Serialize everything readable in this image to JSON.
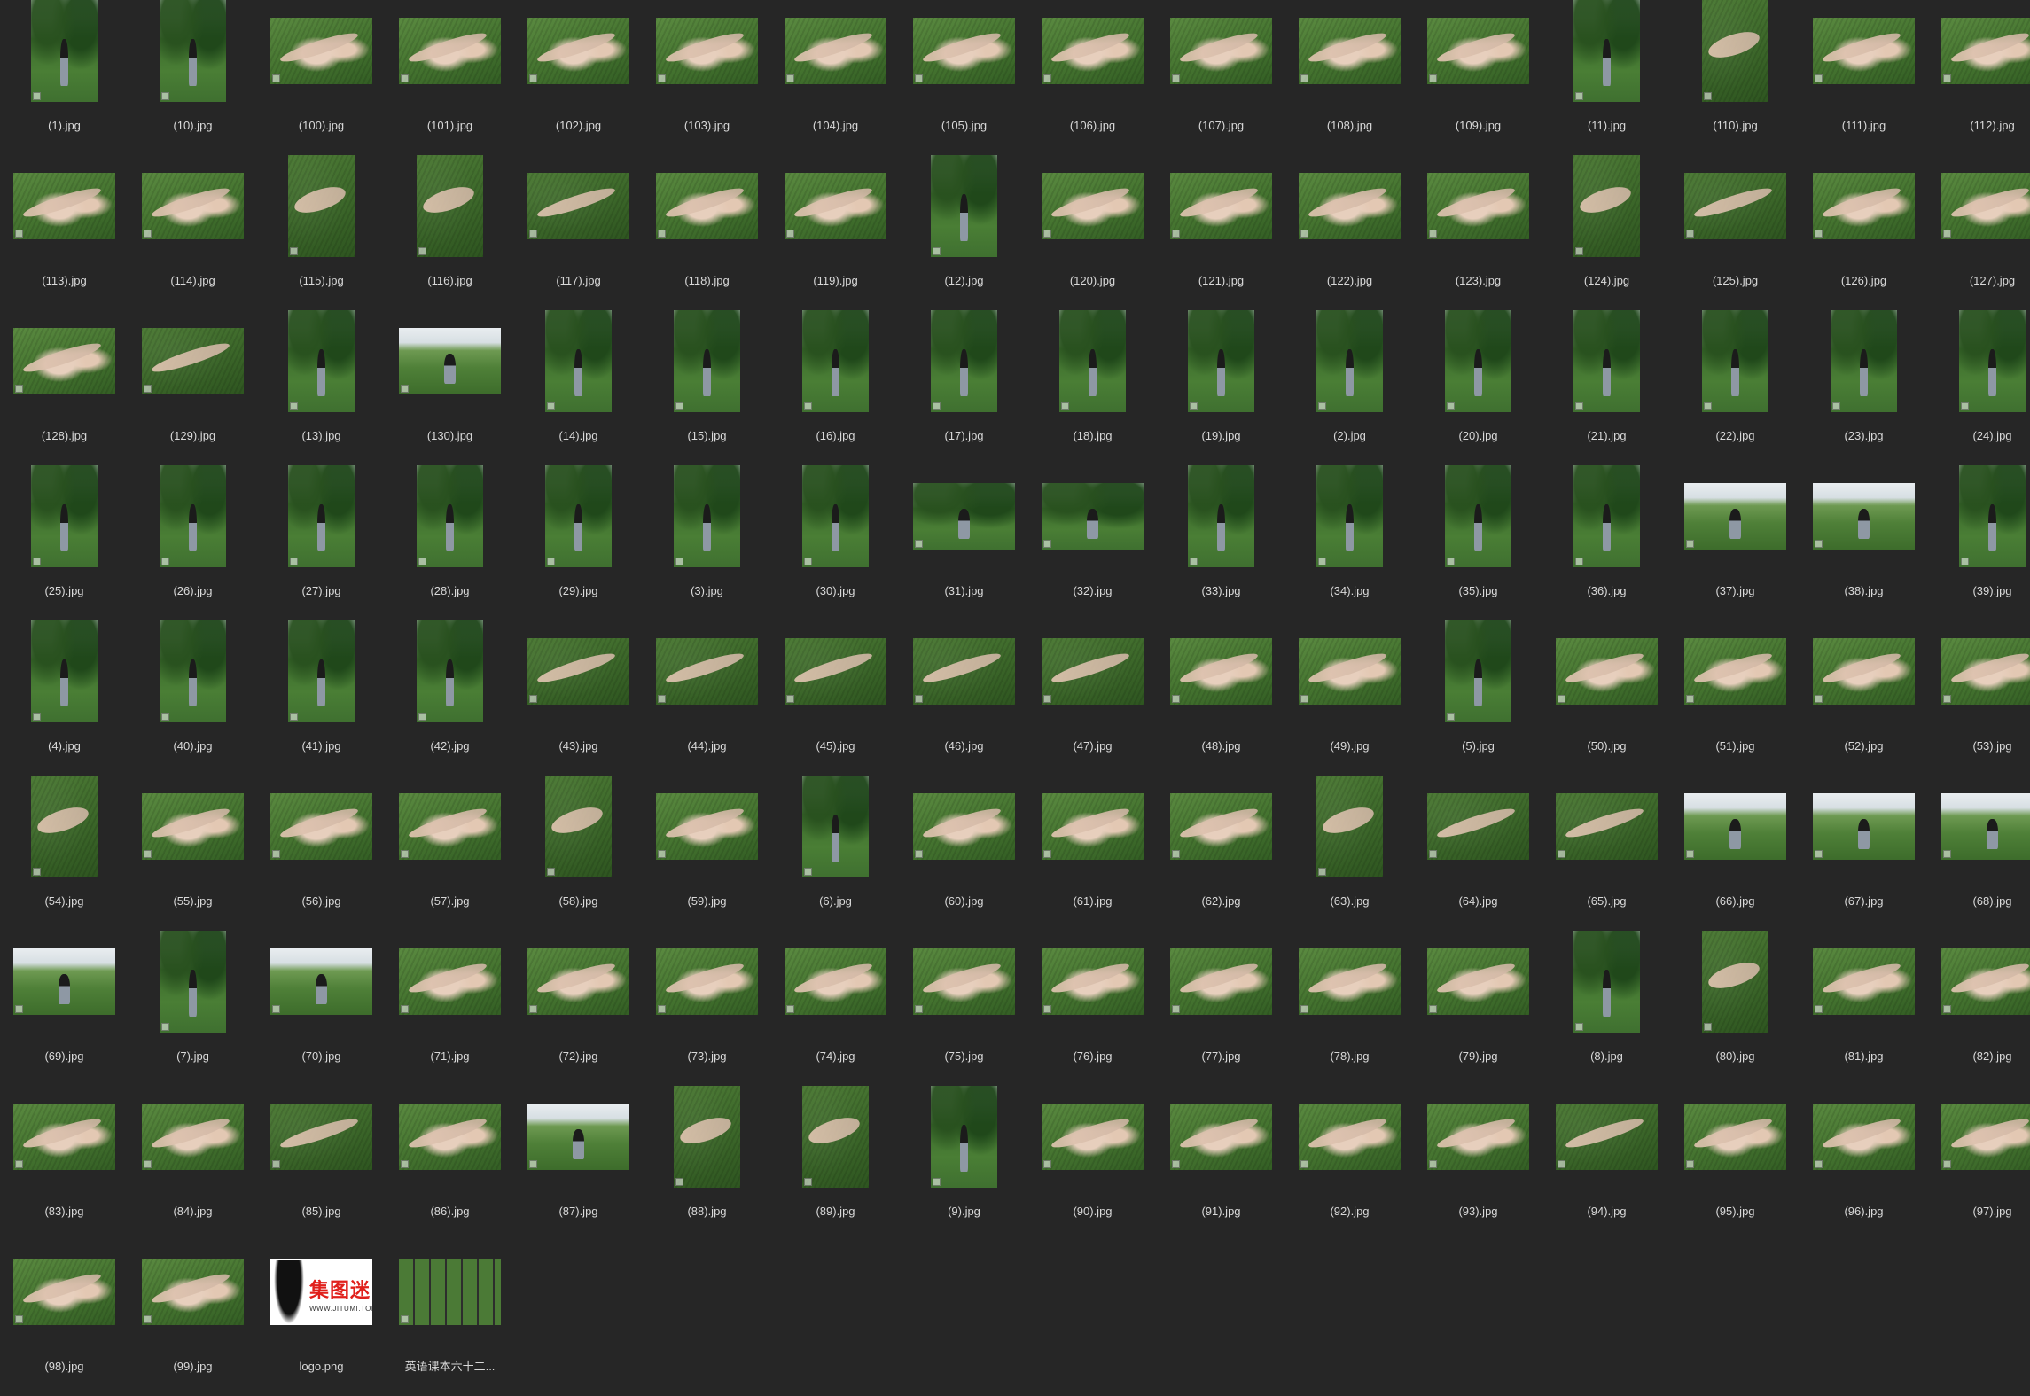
{
  "window": {
    "background": "#262626"
  },
  "grid": {
    "columns": 16,
    "items": [
      {
        "name": "(1).jpg",
        "orientation": "portrait",
        "scene": "trees"
      },
      {
        "name": "(10).jpg",
        "orientation": "portrait",
        "scene": "trees"
      },
      {
        "name": "(100).jpg",
        "orientation": "landscape",
        "scene": "feet"
      },
      {
        "name": "(101).jpg",
        "orientation": "landscape",
        "scene": "feet"
      },
      {
        "name": "(102).jpg",
        "orientation": "landscape",
        "scene": "feet"
      },
      {
        "name": "(103).jpg",
        "orientation": "landscape",
        "scene": "feet"
      },
      {
        "name": "(104).jpg",
        "orientation": "landscape",
        "scene": "feet"
      },
      {
        "name": "(105).jpg",
        "orientation": "landscape",
        "scene": "feet"
      },
      {
        "name": "(106).jpg",
        "orientation": "landscape",
        "scene": "feet"
      },
      {
        "name": "(107).jpg",
        "orientation": "landscape",
        "scene": "feet"
      },
      {
        "name": "(108).jpg",
        "orientation": "landscape",
        "scene": "feet"
      },
      {
        "name": "(109).jpg",
        "orientation": "landscape",
        "scene": "feet"
      },
      {
        "name": "(11).jpg",
        "orientation": "portrait",
        "scene": "trees"
      },
      {
        "name": "(110).jpg",
        "orientation": "portrait",
        "scene": "grass"
      },
      {
        "name": "(111).jpg",
        "orientation": "landscape",
        "scene": "feet"
      },
      {
        "name": "(112).jpg",
        "orientation": "landscape",
        "scene": "feet"
      },
      {
        "name": "(113).jpg",
        "orientation": "landscape",
        "scene": "feet"
      },
      {
        "name": "(114).jpg",
        "orientation": "landscape",
        "scene": "feet"
      },
      {
        "name": "(115).jpg",
        "orientation": "portrait",
        "scene": "grass"
      },
      {
        "name": "(116).jpg",
        "orientation": "portrait",
        "scene": "grass"
      },
      {
        "name": "(117).jpg",
        "orientation": "landscape",
        "scene": "grass"
      },
      {
        "name": "(118).jpg",
        "orientation": "landscape",
        "scene": "feet"
      },
      {
        "name": "(119).jpg",
        "orientation": "landscape",
        "scene": "feet"
      },
      {
        "name": "(12).jpg",
        "orientation": "portrait",
        "scene": "trees"
      },
      {
        "name": "(120).jpg",
        "orientation": "landscape",
        "scene": "feet"
      },
      {
        "name": "(121).jpg",
        "orientation": "landscape",
        "scene": "feet"
      },
      {
        "name": "(122).jpg",
        "orientation": "landscape",
        "scene": "feet"
      },
      {
        "name": "(123).jpg",
        "orientation": "landscape",
        "scene": "feet"
      },
      {
        "name": "(124).jpg",
        "orientation": "portrait",
        "scene": "grass"
      },
      {
        "name": "(125).jpg",
        "orientation": "landscape",
        "scene": "grass"
      },
      {
        "name": "(126).jpg",
        "orientation": "landscape",
        "scene": "feet"
      },
      {
        "name": "(127).jpg",
        "orientation": "landscape",
        "scene": "feet"
      },
      {
        "name": "(128).jpg",
        "orientation": "landscape",
        "scene": "feet"
      },
      {
        "name": "(129).jpg",
        "orientation": "landscape",
        "scene": "grass"
      },
      {
        "name": "(13).jpg",
        "orientation": "portrait",
        "scene": "trees"
      },
      {
        "name": "(130).jpg",
        "orientation": "landscape",
        "scene": "lawn"
      },
      {
        "name": "(14).jpg",
        "orientation": "portrait",
        "scene": "trees"
      },
      {
        "name": "(15).jpg",
        "orientation": "portrait",
        "scene": "trees"
      },
      {
        "name": "(16).jpg",
        "orientation": "portrait",
        "scene": "trees"
      },
      {
        "name": "(17).jpg",
        "orientation": "portrait",
        "scene": "trees"
      },
      {
        "name": "(18).jpg",
        "orientation": "portrait",
        "scene": "trees"
      },
      {
        "name": "(19).jpg",
        "orientation": "portrait",
        "scene": "trees"
      },
      {
        "name": "(2).jpg",
        "orientation": "portrait",
        "scene": "trees"
      },
      {
        "name": "(20).jpg",
        "orientation": "portrait",
        "scene": "trees"
      },
      {
        "name": "(21).jpg",
        "orientation": "portrait",
        "scene": "trees"
      },
      {
        "name": "(22).jpg",
        "orientation": "portrait",
        "scene": "trees"
      },
      {
        "name": "(23).jpg",
        "orientation": "portrait",
        "scene": "trees"
      },
      {
        "name": "(24).jpg",
        "orientation": "portrait",
        "scene": "trees"
      },
      {
        "name": "(25).jpg",
        "orientation": "portrait",
        "scene": "trees"
      },
      {
        "name": "(26).jpg",
        "orientation": "portrait",
        "scene": "trees"
      },
      {
        "name": "(27).jpg",
        "orientation": "portrait",
        "scene": "trees"
      },
      {
        "name": "(28).jpg",
        "orientation": "portrait",
        "scene": "trees"
      },
      {
        "name": "(29).jpg",
        "orientation": "portrait",
        "scene": "trees"
      },
      {
        "name": "(3).jpg",
        "orientation": "portrait",
        "scene": "trees"
      },
      {
        "name": "(30).jpg",
        "orientation": "portrait",
        "scene": "trees"
      },
      {
        "name": "(31).jpg",
        "orientation": "landscape",
        "scene": "trees"
      },
      {
        "name": "(32).jpg",
        "orientation": "landscape",
        "scene": "trees"
      },
      {
        "name": "(33).jpg",
        "orientation": "portrait",
        "scene": "trees"
      },
      {
        "name": "(34).jpg",
        "orientation": "portrait",
        "scene": "trees"
      },
      {
        "name": "(35).jpg",
        "orientation": "portrait",
        "scene": "trees"
      },
      {
        "name": "(36).jpg",
        "orientation": "portrait",
        "scene": "trees"
      },
      {
        "name": "(37).jpg",
        "orientation": "landscape",
        "scene": "lawn"
      },
      {
        "name": "(38).jpg",
        "orientation": "landscape",
        "scene": "lawn"
      },
      {
        "name": "(39).jpg",
        "orientation": "portrait",
        "scene": "trees"
      },
      {
        "name": "(4).jpg",
        "orientation": "portrait",
        "scene": "trees"
      },
      {
        "name": "(40).jpg",
        "orientation": "portrait",
        "scene": "trees"
      },
      {
        "name": "(41).jpg",
        "orientation": "portrait",
        "scene": "trees"
      },
      {
        "name": "(42).jpg",
        "orientation": "portrait",
        "scene": "trees"
      },
      {
        "name": "(43).jpg",
        "orientation": "landscape",
        "scene": "grass"
      },
      {
        "name": "(44).jpg",
        "orientation": "landscape",
        "scene": "grass"
      },
      {
        "name": "(45).jpg",
        "orientation": "landscape",
        "scene": "grass"
      },
      {
        "name": "(46).jpg",
        "orientation": "landscape",
        "scene": "grass"
      },
      {
        "name": "(47).jpg",
        "orientation": "landscape",
        "scene": "grass"
      },
      {
        "name": "(48).jpg",
        "orientation": "landscape",
        "scene": "feet"
      },
      {
        "name": "(49).jpg",
        "orientation": "landscape",
        "scene": "feet"
      },
      {
        "name": "(5).jpg",
        "orientation": "portrait",
        "scene": "trees"
      },
      {
        "name": "(50).jpg",
        "orientation": "landscape",
        "scene": "feet"
      },
      {
        "name": "(51).jpg",
        "orientation": "landscape",
        "scene": "feet"
      },
      {
        "name": "(52).jpg",
        "orientation": "landscape",
        "scene": "feet"
      },
      {
        "name": "(53).jpg",
        "orientation": "landscape",
        "scene": "feet"
      },
      {
        "name": "(54).jpg",
        "orientation": "portrait",
        "scene": "grass"
      },
      {
        "name": "(55).jpg",
        "orientation": "landscape",
        "scene": "feet"
      },
      {
        "name": "(56).jpg",
        "orientation": "landscape",
        "scene": "feet"
      },
      {
        "name": "(57).jpg",
        "orientation": "landscape",
        "scene": "feet"
      },
      {
        "name": "(58).jpg",
        "orientation": "portrait",
        "scene": "grass"
      },
      {
        "name": "(59).jpg",
        "orientation": "landscape",
        "scene": "feet"
      },
      {
        "name": "(6).jpg",
        "orientation": "portrait",
        "scene": "trees"
      },
      {
        "name": "(60).jpg",
        "orientation": "landscape",
        "scene": "feet"
      },
      {
        "name": "(61).jpg",
        "orientation": "landscape",
        "scene": "feet"
      },
      {
        "name": "(62).jpg",
        "orientation": "landscape",
        "scene": "feet"
      },
      {
        "name": "(63).jpg",
        "orientation": "portrait",
        "scene": "grass"
      },
      {
        "name": "(64).jpg",
        "orientation": "landscape",
        "scene": "grass"
      },
      {
        "name": "(65).jpg",
        "orientation": "landscape",
        "scene": "grass"
      },
      {
        "name": "(66).jpg",
        "orientation": "landscape",
        "scene": "lawn"
      },
      {
        "name": "(67).jpg",
        "orientation": "landscape",
        "scene": "lawn"
      },
      {
        "name": "(68).jpg",
        "orientation": "landscape",
        "scene": "lawn"
      },
      {
        "name": "(69).jpg",
        "orientation": "landscape",
        "scene": "lawn"
      },
      {
        "name": "(7).jpg",
        "orientation": "portrait",
        "scene": "trees"
      },
      {
        "name": "(70).jpg",
        "orientation": "landscape",
        "scene": "lawn"
      },
      {
        "name": "(71).jpg",
        "orientation": "landscape",
        "scene": "feet"
      },
      {
        "name": "(72).jpg",
        "orientation": "landscape",
        "scene": "feet"
      },
      {
        "name": "(73).jpg",
        "orientation": "landscape",
        "scene": "feet"
      },
      {
        "name": "(74).jpg",
        "orientation": "landscape",
        "scene": "feet"
      },
      {
        "name": "(75).jpg",
        "orientation": "landscape",
        "scene": "feet"
      },
      {
        "name": "(76).jpg",
        "orientation": "landscape",
        "scene": "feet"
      },
      {
        "name": "(77).jpg",
        "orientation": "landscape",
        "scene": "feet"
      },
      {
        "name": "(78).jpg",
        "orientation": "landscape",
        "scene": "feet"
      },
      {
        "name": "(79).jpg",
        "orientation": "landscape",
        "scene": "feet"
      },
      {
        "name": "(8).jpg",
        "orientation": "portrait",
        "scene": "trees"
      },
      {
        "name": "(80).jpg",
        "orientation": "portrait",
        "scene": "grass"
      },
      {
        "name": "(81).jpg",
        "orientation": "landscape",
        "scene": "feet"
      },
      {
        "name": "(82).jpg",
        "orientation": "landscape",
        "scene": "feet"
      },
      {
        "name": "(83).jpg",
        "orientation": "landscape",
        "scene": "feet"
      },
      {
        "name": "(84).jpg",
        "orientation": "landscape",
        "scene": "feet"
      },
      {
        "name": "(85).jpg",
        "orientation": "landscape",
        "scene": "grass"
      },
      {
        "name": "(86).jpg",
        "orientation": "landscape",
        "scene": "feet"
      },
      {
        "name": "(87).jpg",
        "orientation": "landscape",
        "scene": "lawn"
      },
      {
        "name": "(88).jpg",
        "orientation": "portrait",
        "scene": "grass"
      },
      {
        "name": "(89).jpg",
        "orientation": "portrait",
        "scene": "grass"
      },
      {
        "name": "(9).jpg",
        "orientation": "portrait",
        "scene": "trees"
      },
      {
        "name": "(90).jpg",
        "orientation": "landscape",
        "scene": "feet"
      },
      {
        "name": "(91).jpg",
        "orientation": "landscape",
        "scene": "feet"
      },
      {
        "name": "(92).jpg",
        "orientation": "landscape",
        "scene": "feet"
      },
      {
        "name": "(93).jpg",
        "orientation": "landscape",
        "scene": "feet"
      },
      {
        "name": "(94).jpg",
        "orientation": "landscape",
        "scene": "grass"
      },
      {
        "name": "(95).jpg",
        "orientation": "landscape",
        "scene": "feet"
      },
      {
        "name": "(96).jpg",
        "orientation": "landscape",
        "scene": "feet"
      },
      {
        "name": "(97).jpg",
        "orientation": "landscape",
        "scene": "feet"
      },
      {
        "name": "(98).jpg",
        "orientation": "landscape",
        "scene": "feet"
      },
      {
        "name": "(99).jpg",
        "orientation": "landscape",
        "scene": "feet"
      },
      {
        "name": "logo.png",
        "orientation": "logo",
        "scene": "logo",
        "logo_text": "集图迷",
        "logo_url": "WWW.JITUMI.TOP"
      },
      {
        "name": "英语课本六十二...",
        "orientation": "landscape",
        "scene": "sheet"
      }
    ]
  },
  "colors": {
    "label_text": "#d9d9d9",
    "logo_red": "#e0201b"
  }
}
